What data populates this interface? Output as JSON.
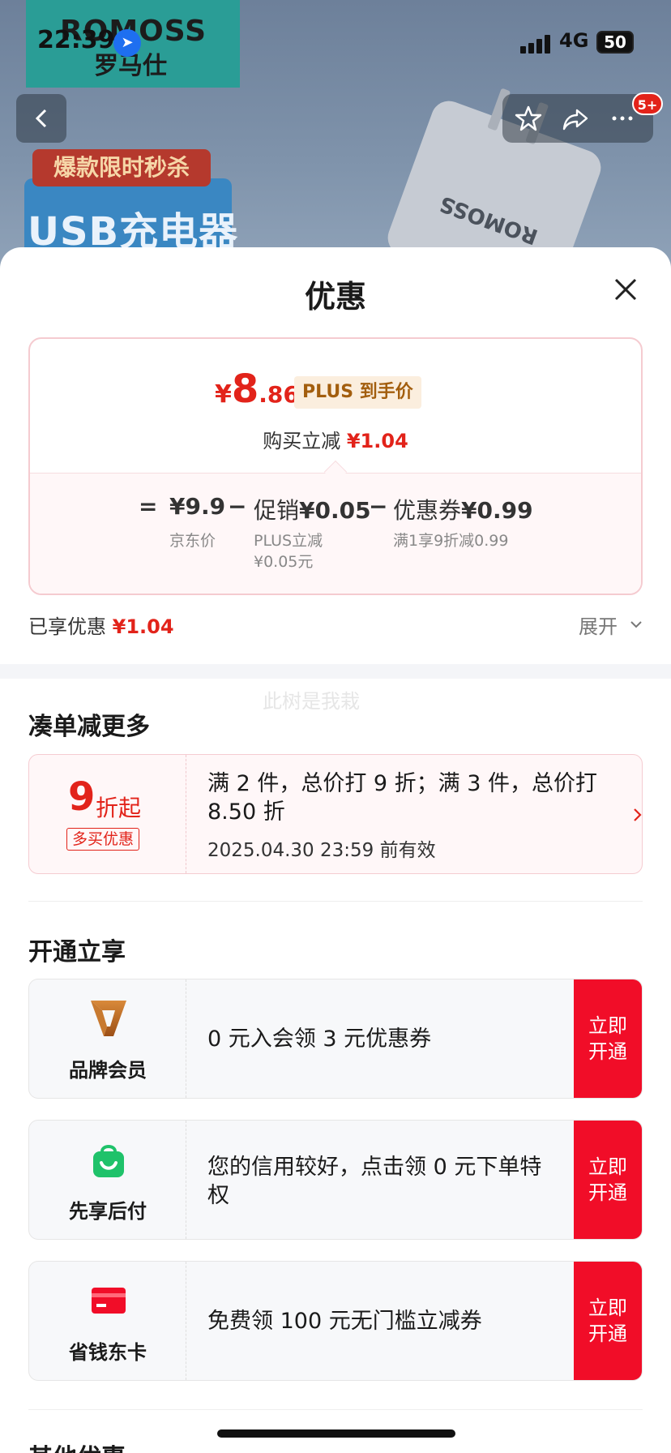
{
  "background": {
    "brand_en": "ROMOSS",
    "brand_cn": "罗马仕",
    "promo_tag": "爆款限时秒杀",
    "promo_title": "USB充电器",
    "product_text": "ROMOSS"
  },
  "status_bar": {
    "time": "22:39",
    "network": "4G",
    "battery": "50"
  },
  "nav": {
    "badge": "5+"
  },
  "sheet": {
    "title": "优惠",
    "price": {
      "currency": "¥",
      "integer": "8",
      "decimal": ".86"
    },
    "plus_tag": "PLUS 到手价",
    "reduce_label": "购买立减",
    "reduce_amount": "¥1.04",
    "formula": {
      "eq": "=",
      "jd_price": "¥9.9",
      "minus1": "−",
      "promo_label": "促销",
      "promo_amount": "¥0.05",
      "minus2": "−",
      "coupon_label": "优惠券",
      "coupon_amount": "¥0.99",
      "jd_note": "京东价",
      "promo_note_1": "PLUS立减",
      "promo_note_2": "¥0.05元",
      "coupon_note": "满1享9折减0.99"
    },
    "enjoyed_label": "已享优惠",
    "enjoyed_amount": "¥1.04",
    "expand_label": "展开",
    "watermark": "此树是我栽"
  },
  "combo": {
    "section_title": "凑单减更多",
    "big": "9",
    "small": "折起",
    "tag": "多买优惠",
    "desc": "满 2 件，总价打 9 折；满 3 件，总价打 8.50 折",
    "expiry": "2025.04.30 23:59 前有效"
  },
  "open": {
    "section_title": "开通立享",
    "items": [
      {
        "name": "品牌会员",
        "icon": "brand-v-icon",
        "desc": "0 元入会领 3 元优惠券",
        "button": "立即开通"
      },
      {
        "name": "先享后付",
        "icon": "shopping-bag-icon",
        "desc": "您的信用较好，点击领 0 元下单特权",
        "button": "立即开通"
      },
      {
        "name": "省钱东卡",
        "icon": "card-icon",
        "desc": "免费领 100 元无门槛立减券",
        "button": "立即开通"
      }
    ]
  },
  "other": {
    "section_title": "其他优惠"
  },
  "colors": {
    "accent_red": "#e2231a",
    "button_red": "#f10d28",
    "plus_gold": "#a35e0e"
  }
}
